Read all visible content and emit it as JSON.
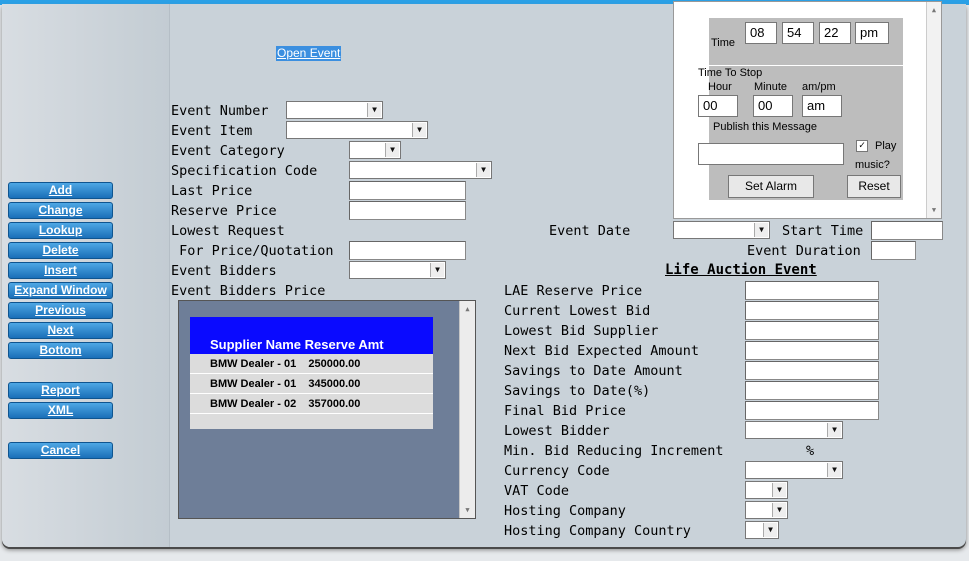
{
  "sidebar": {
    "buttons": [
      "Add",
      "Change",
      "Lookup",
      "Delete",
      "Insert",
      "Expand Window",
      "Previous",
      "Next",
      "Bottom"
    ],
    "report": "Report",
    "xml": "XML",
    "cancel": "Cancel"
  },
  "header": {
    "open_event": "Open Event"
  },
  "form": {
    "event_number": "Event Number",
    "event_item": "Event Item",
    "event_category": "Event Category",
    "specification_code": "Specification Code",
    "last_price": "Last Price",
    "reserve_price": "Reserve Price",
    "lowest_request": "Lowest Request",
    "for_price_quotation": " For Price/Quotation",
    "event_bidders": "Event Bidders",
    "event_bidders_price": "Event Bidders Price",
    "event_date": "Event Date",
    "start_time": "Start Time",
    "event_duration": "Event Duration"
  },
  "life_auction": {
    "title": "Life Auction Event",
    "lae_reserve_price": "LAE Reserve Price",
    "current_lowest_bid": "Current Lowest Bid",
    "lowest_bid_supplier": "Lowest Bid Supplier",
    "next_bid_expected_amount": "Next Bid Expected Amount",
    "savings_to_date_amount": "Savings to Date Amount",
    "savings_to_date_pct": "Savings to Date(%)",
    "final_bid_price": "Final Bid Price",
    "lowest_bidder": "Lowest Bidder",
    "min_bid_reducing_increment": "Min. Bid Reducing Increment",
    "percent": "%",
    "currency_code": "Currency Code",
    "vat_code": "VAT Code",
    "hosting_company": "Hosting Company",
    "hosting_company_country": "Hosting Company Country"
  },
  "bidders_table": {
    "columns": "Supplier Name Reserve Amt",
    "rows": [
      "BMW Dealer - 01    250000.00",
      "BMW Dealer - 01    345000.00",
      "BMW Dealer - 02    357000.00"
    ]
  },
  "alarm": {
    "time_label": "Time",
    "hour": "08",
    "minute": "54",
    "second": "22",
    "ampm": "pm",
    "time_to_stop": "Time To Stop",
    "hour_label": "Hour",
    "minute_label": "Minute",
    "ampm_label": "am/pm",
    "stop_hour": "00",
    "stop_minute": "00",
    "stop_ampm": "am",
    "publish_label": "Publish this Message",
    "message": "",
    "play_label": "Play",
    "music_label": "music?",
    "check": "✓",
    "set_alarm": "Set Alarm",
    "reset": "Reset"
  }
}
